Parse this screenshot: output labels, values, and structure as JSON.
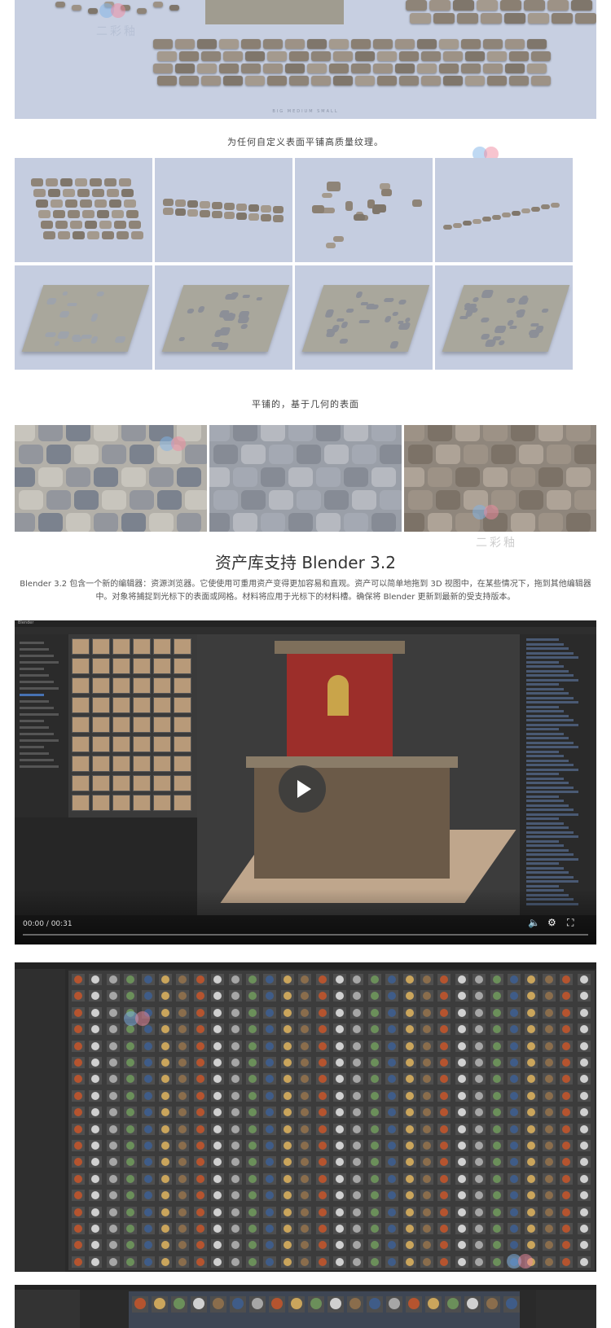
{
  "hero": {
    "subtitle": "BIG MEDIUM SMALL"
  },
  "caption1": "为任何自定义表面平铺高质量纹理。",
  "caption2": "平铺的，基于几何的表面",
  "watermark": "二彩釉",
  "section": {
    "title": "资产库支持 Blender 3.2",
    "description": "Blender 3.2 包含一个新的编辑器：资源浏览器。它使使用可重用资产变得更加容易和直观。资产可以简单地拖到 3D 视图中，在某些情况下，拖到其他编辑器中。对象将捕捉到光标下的表面或网格。材料将应用于光标下的材料槽。确保将 Blender 更新到最新的受支持版本。"
  },
  "video": {
    "time": "00:00 / 00:31",
    "progress": 0,
    "window_title": "Blender",
    "icons": [
      "play-icon",
      "volume-icon",
      "gear-icon",
      "fullscreen-icon"
    ]
  },
  "colors": {
    "sky": "#c7cfe1",
    "stone": "#8e8478",
    "blender_bg": "#1d1d1d",
    "accent": "#4772b3"
  }
}
